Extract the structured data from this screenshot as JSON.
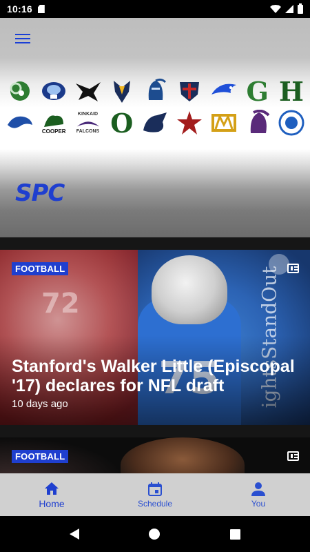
{
  "status_bar": {
    "time": "10:16"
  },
  "header": {
    "conference_logo_text": "SPC",
    "team_logos": [
      {
        "name": "ram-logo",
        "color": "#2e7d32"
      },
      {
        "name": "eagle-blue-logo",
        "color": "#1b3a8a"
      },
      {
        "name": "hawk-black-logo",
        "color": "#111111"
      },
      {
        "name": "mustang-logo",
        "color": "#1a2d5a"
      },
      {
        "name": "knight-helmet-logo",
        "color": "#1d4c8f"
      },
      {
        "name": "crusader-shield-logo",
        "color": "#8b1a1a"
      },
      {
        "name": "eagle-swoosh-logo",
        "color": "#1f4fd8"
      },
      {
        "name": "g-letter-logo",
        "color": "#2e7d32"
      },
      {
        "name": "h-letter-logo",
        "color": "#1b5e20"
      },
      {
        "name": "mustang-blue-logo",
        "color": "#1f4fa8"
      },
      {
        "name": "cooper-dragon-logo",
        "color": "#1b5e20"
      },
      {
        "name": "kinkaid-falcons-logo",
        "color": "#4a2a7a"
      },
      {
        "name": "o-letter-logo",
        "color": "#1b5e20"
      },
      {
        "name": "mustang-dark-logo",
        "color": "#1a2d5a"
      },
      {
        "name": "star-logo",
        "color": "#a31d1d"
      },
      {
        "name": "sm-monogram-logo",
        "color": "#d4a017"
      },
      {
        "name": "spartan-logo",
        "color": "#5a2a7a"
      },
      {
        "name": "trinity-valley-logo",
        "color": "#1f5fbf"
      }
    ],
    "logo_text_cooper": "COOPER",
    "logo_text_kinkaid": "KINKAID",
    "logo_text_falcons": "FALCONS",
    "logo_letter_g": "G",
    "logo_letter_h": "H",
    "logo_letter_o": "O"
  },
  "articles": [
    {
      "category": "FOOTBALL",
      "title": "Stanford's Walker Little (Episcopal '17) declares for NFL draft",
      "time_ago": "10 days ago",
      "photo_text_number_left": "72",
      "photo_text_number_right": "75",
      "photo_text_side": "ightsStandOut"
    },
    {
      "category": "FOOTBALL"
    }
  ],
  "bottom_nav": {
    "items": [
      {
        "label": "Home",
        "icon": "home-icon",
        "active": true
      },
      {
        "label": "Schedule",
        "icon": "calendar-icon",
        "active": false
      },
      {
        "label": "You",
        "icon": "person-icon",
        "active": false
      }
    ]
  },
  "colors": {
    "accent": "#1f3fcf",
    "nav_background": "#d0d0d0",
    "header_line": "#1f4fd8"
  }
}
